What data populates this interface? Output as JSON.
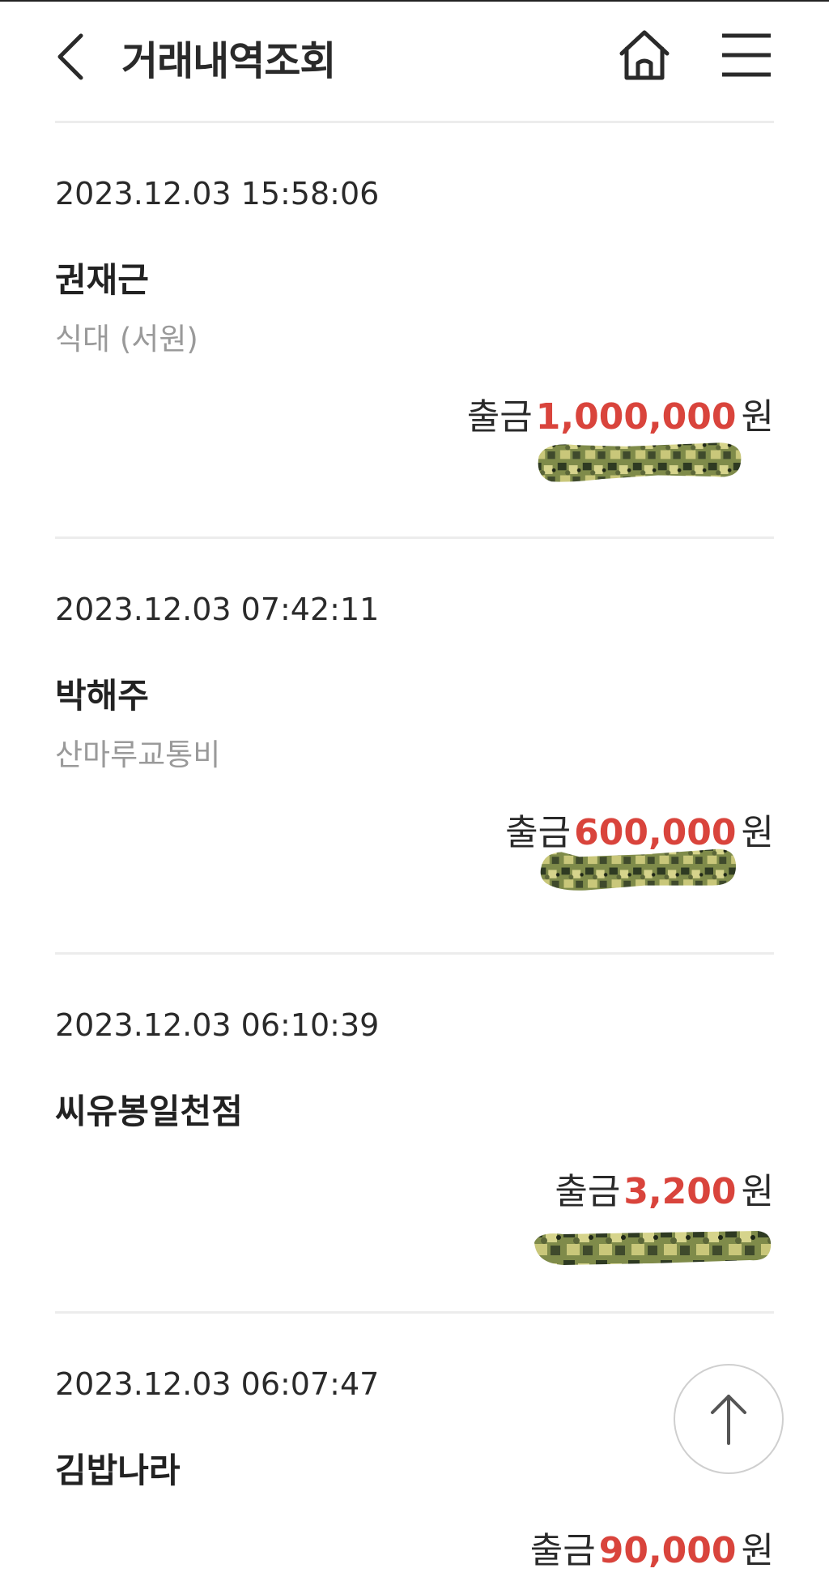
{
  "header": {
    "title": "거래내역조회",
    "back_icon": "chevron-left-icon",
    "home_icon": "home-icon",
    "menu_icon": "hamburger-menu-icon"
  },
  "transactions": [
    {
      "datetime": "2023.12.03 15:58:06",
      "name": "권재근",
      "memo": "식대 (서원)",
      "type": "출금",
      "amount": "1,000,000",
      "unit": "원"
    },
    {
      "datetime": "2023.12.03 07:42:11",
      "name": "박해주",
      "memo": "산마루교통비",
      "type": "출금",
      "amount": "600,000",
      "unit": "원"
    },
    {
      "datetime": "2023.12.03 06:10:39",
      "name": "씨유봉일천점",
      "memo": "",
      "type": "출금",
      "amount": "3,200",
      "unit": "원"
    },
    {
      "datetime": "2023.12.03 06:07:47",
      "name": "김밥나라",
      "memo": "",
      "type": "출금",
      "amount": "90,000",
      "unit": "원"
    }
  ],
  "scroll_top": {
    "icon": "arrow-up-icon"
  },
  "colors": {
    "amount": "#d9443c",
    "memo": "#9a9a9a",
    "divider": "#ececec",
    "redaction_light": "#c9c77a",
    "redaction_dark": "#2e3a22"
  }
}
